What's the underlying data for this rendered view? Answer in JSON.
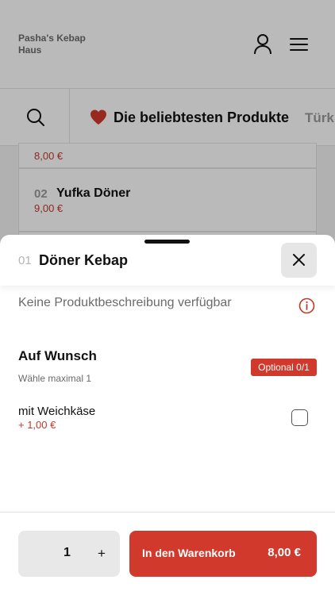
{
  "header": {
    "brand_name": "Pasha's Kebap Haus",
    "user_icon": "user-icon",
    "menu_icon": "hamburger-menu-icon"
  },
  "categories": {
    "search_icon": "search-icon",
    "active_icon": "heart-icon",
    "active_label": "Die beliebtesten Produkte",
    "next_label": "Türk"
  },
  "background_products": [
    {
      "number": "",
      "name": "",
      "price": "8,00 €"
    },
    {
      "number": "02",
      "name": "Yufka Döner",
      "price": "9,00 €"
    }
  ],
  "sheet": {
    "product_number": "01",
    "product_name": "Döner Kebap",
    "close_icon": "close-icon",
    "description": "Keine Produktbeschreibung verfügbar",
    "info_icon": "info-icon",
    "option_group": {
      "title": "Auf Wunsch",
      "subtitle": "Wähle maximal 1",
      "badge": "Optional 0/1",
      "items": [
        {
          "name": "mit Weichkäse",
          "price": "+ 1,00 €",
          "checked": false
        }
      ]
    },
    "footer": {
      "quantity": "1",
      "plus_label": "+",
      "cart_label": "In den Warenkorb",
      "cart_price": "8,00 €"
    }
  },
  "colors": {
    "accent": "#d0392b",
    "price_text": "#c0392b"
  }
}
